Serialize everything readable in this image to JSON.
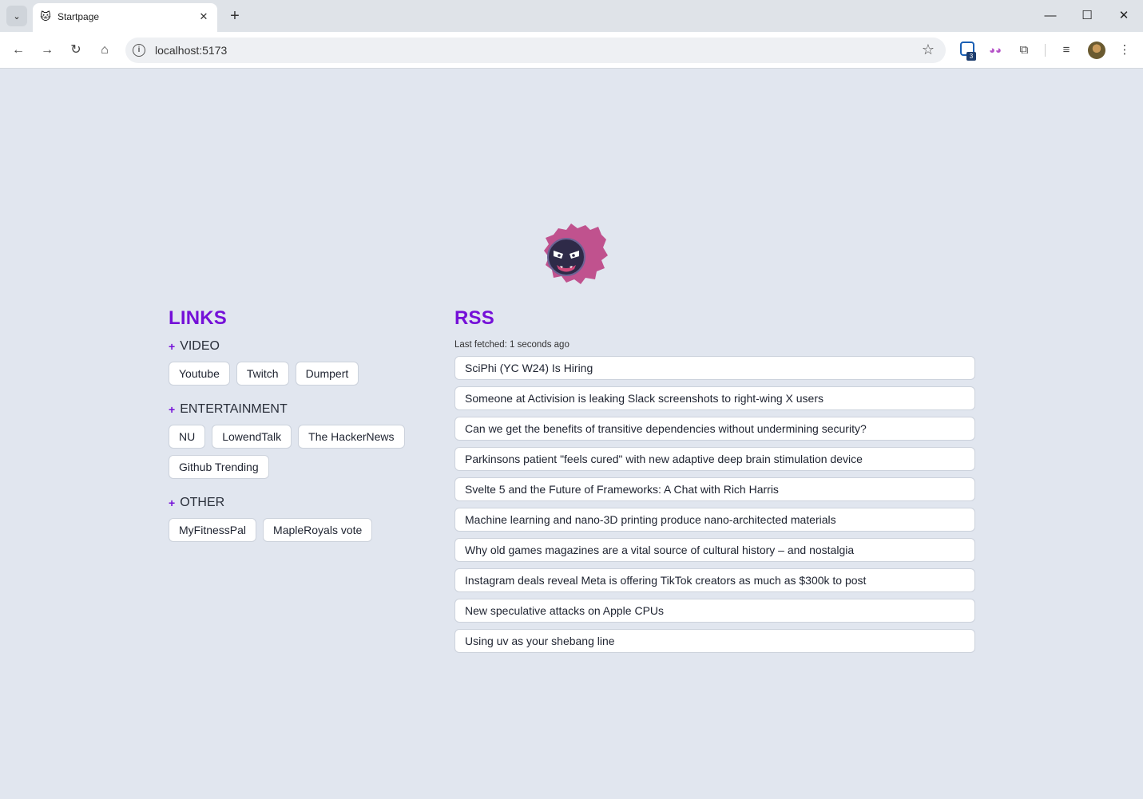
{
  "browser": {
    "tab_title": "Startpage",
    "url": "localhost:5173",
    "extension_badge_count": "3"
  },
  "links": {
    "title": "LINKS",
    "groups": [
      {
        "name": "VIDEO",
        "items": [
          "Youtube",
          "Twitch",
          "Dumpert"
        ]
      },
      {
        "name": "ENTERTAINMENT",
        "items": [
          "NU",
          "LowendTalk",
          "The HackerNews",
          "Github Trending"
        ]
      },
      {
        "name": "OTHER",
        "items": [
          "MyFitnessPal",
          "MapleRoyals vote"
        ]
      }
    ]
  },
  "rss": {
    "title": "RSS",
    "last_fetched": "Last fetched: 1 seconds ago",
    "items": [
      "SciPhi (YC W24) Is Hiring",
      "Someone at Activision is leaking Slack screenshots to right-wing X users",
      "Can we get the benefits of transitive dependencies without undermining security?",
      "Parkinsons patient \"feels cured\" with new adaptive deep brain stimulation device",
      "Svelte 5 and the Future of Frameworks: A Chat with Rich Harris",
      "Machine learning and nano-3D printing produce nano-architected materials",
      "Why old games magazines are a vital source of cultural history – and nostalgia",
      "Instagram deals reveal Meta is offering TikTok creators as much as $300k to post",
      "New speculative attacks on Apple CPUs",
      "Using uv as your shebang line"
    ]
  },
  "colors": {
    "accent": "#7510d8",
    "page_bg": "#e1e6ef"
  }
}
